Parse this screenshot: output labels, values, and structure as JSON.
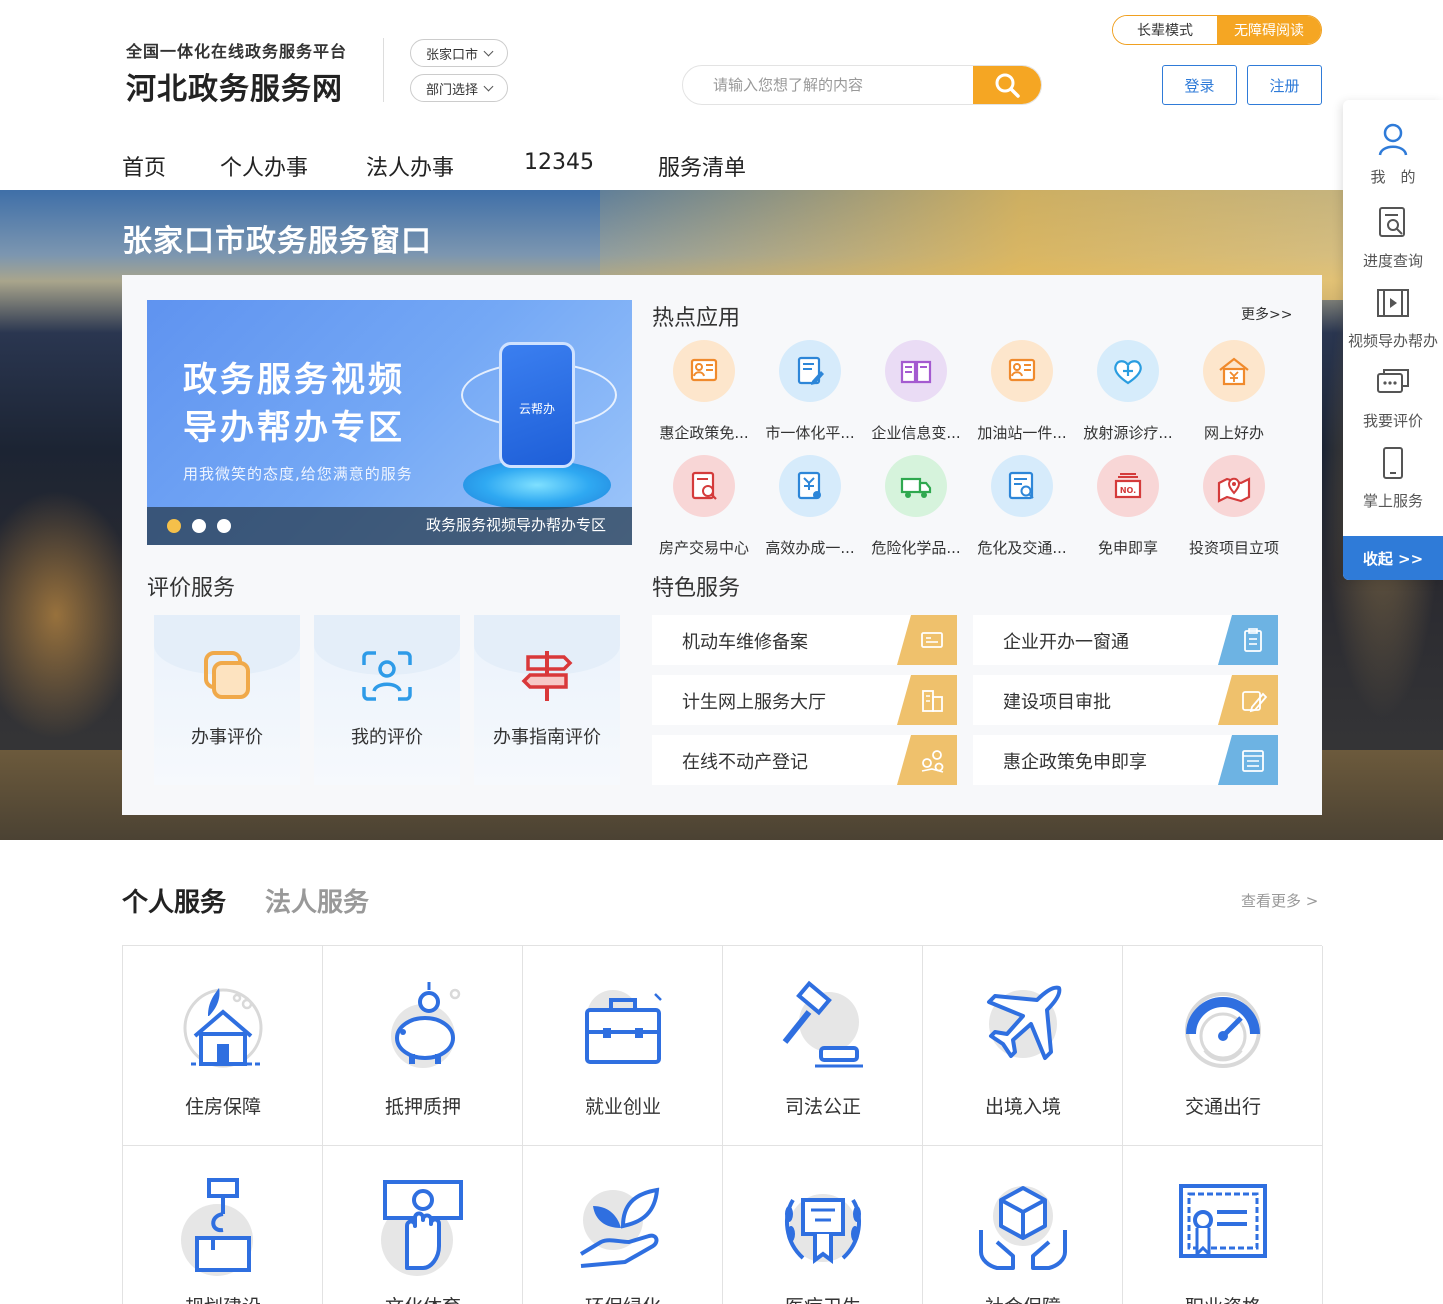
{
  "header": {
    "platform_subtitle": "全国一体化在线政务服务平台",
    "site_name": "河北政务服务网",
    "city_select": "张家口市",
    "dept_select": "部门选择",
    "search_placeholder": "请输入您想了解的内容",
    "mode_elder": "长辈模式",
    "mode_accessible": "无障碍阅读",
    "login": "登录",
    "register": "注册",
    "accent_color": "#f5a623",
    "primary_color": "#2f7bd8"
  },
  "nav": [
    "首页",
    "个人办事",
    "法人办事",
    "12345",
    "服务清单"
  ],
  "banner": {
    "title": "张家口市政务服务窗口",
    "carousel": {
      "headline_1": "政务服务视频",
      "headline_2": "导办帮办专区",
      "slogan": "用我微笑的态度,给您满意的服务",
      "caption": "政务服务视频导办帮办专区",
      "phone_text": "云帮办",
      "active_slide": 1,
      "slide_count": 3
    }
  },
  "hot_apps": {
    "title": "热点应用",
    "more": "更多>>",
    "items": [
      {
        "label": "惠企政策免...",
        "icon": "person-card-icon"
      },
      {
        "label": "市一体化平...",
        "icon": "document-edit-icon"
      },
      {
        "label": "企业信息变...",
        "icon": "open-book-icon"
      },
      {
        "label": "加油站一件...",
        "icon": "person-card-icon"
      },
      {
        "label": "放射源诊疗...",
        "icon": "heart-plus-icon"
      },
      {
        "label": "网上好办",
        "icon": "house-yuan-icon"
      },
      {
        "label": "房产交易中心",
        "icon": "document-search-icon"
      },
      {
        "label": "高效办成一...",
        "icon": "yuan-document-icon"
      },
      {
        "label": "危险化学品...",
        "icon": "truck-icon"
      },
      {
        "label": "危化及交通...",
        "icon": "list-search-icon"
      },
      {
        "label": "免申即享",
        "icon": "number-ticket-icon"
      },
      {
        "label": "投资项目立项",
        "icon": "map-pin-icon"
      }
    ]
  },
  "evaluation": {
    "title": "评价服务",
    "cards": [
      {
        "label": "办事评价",
        "icon": "overlapping-squares-icon"
      },
      {
        "label": "我的评价",
        "icon": "user-scan-icon"
      },
      {
        "label": "办事指南评价",
        "icon": "signpost-icon"
      }
    ]
  },
  "featured": {
    "title": "特色服务",
    "items": [
      {
        "label": "机动车维修备案",
        "icon": "id-card-icon",
        "tag_color": "#efc16c"
      },
      {
        "label": "企业开办一窗通",
        "icon": "clipboard-icon",
        "tag_color": "#6db3e3"
      },
      {
        "label": "计生网上服务大厅",
        "icon": "building-icon",
        "tag_color": "#efc16c"
      },
      {
        "label": "建设项目审批",
        "icon": "pen-edit-icon",
        "tag_color": "#efc16c"
      },
      {
        "label": "在线不动产登记",
        "icon": "map-nodes-icon",
        "tag_color": "#efc16c"
      },
      {
        "label": "惠企政策免申即享",
        "icon": "list-doc-icon",
        "tag_color": "#6db3e3"
      }
    ]
  },
  "services": {
    "tab_personal": "个人服务",
    "tab_legal": "法人服务",
    "see_more": "查看更多 >",
    "items": [
      {
        "label": "住房保障",
        "icon": "house-plant-icon"
      },
      {
        "label": "抵押质押",
        "icon": "piggy-bank-icon"
      },
      {
        "label": "就业创业",
        "icon": "briefcase-icon"
      },
      {
        "label": "司法公正",
        "icon": "gavel-icon"
      },
      {
        "label": "出境入境",
        "icon": "airplane-icon"
      },
      {
        "label": "交通出行",
        "icon": "speedometer-icon"
      },
      {
        "label": "规划建设",
        "icon": "crane-hook-icon"
      },
      {
        "label": "文化体育",
        "icon": "hand-banknote-icon"
      },
      {
        "label": "环保绿化",
        "icon": "hand-sprout-icon"
      },
      {
        "label": "医疗卫生",
        "icon": "laurel-certificate-icon"
      },
      {
        "label": "社会保障",
        "icon": "hands-box-icon"
      },
      {
        "label": "职业资格",
        "icon": "certificate-icon"
      }
    ]
  },
  "sidebar": {
    "items": [
      {
        "label": "我　的",
        "icon": "user-icon"
      },
      {
        "label": "进度查询",
        "icon": "doc-search-icon"
      },
      {
        "label": "视频导办帮办",
        "icon": "film-icon"
      },
      {
        "label": "我要评价",
        "icon": "chat-icon"
      },
      {
        "label": "掌上服务",
        "icon": "phone-icon"
      }
    ],
    "collapse": "收起 >>"
  }
}
